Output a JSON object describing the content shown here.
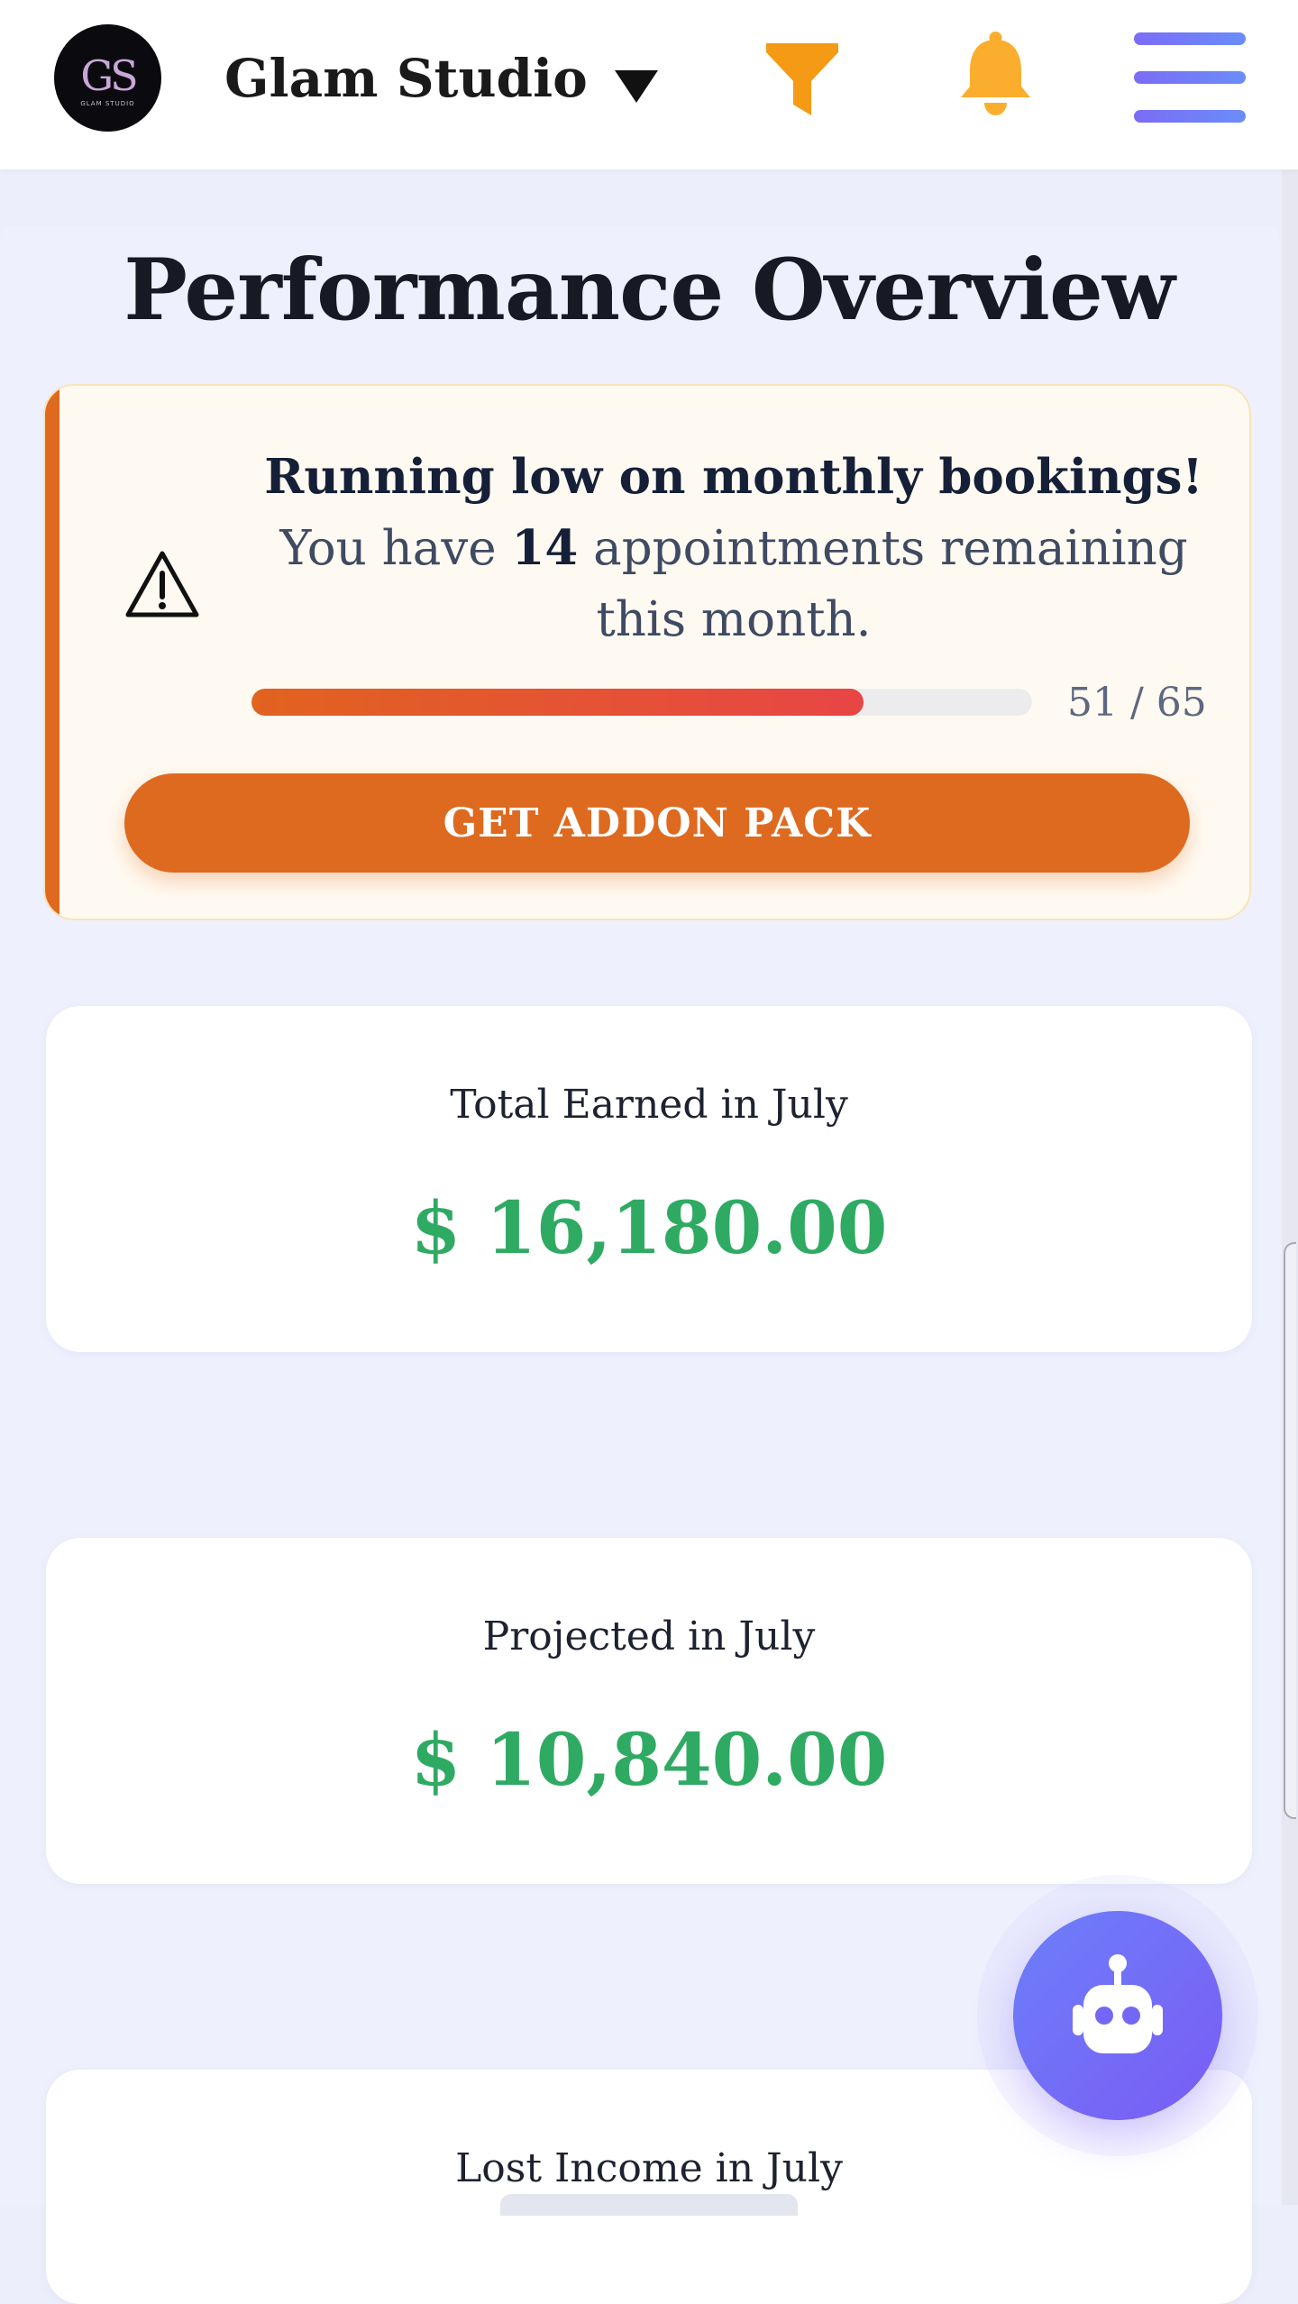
{
  "header": {
    "studio_name": "Glam Studio",
    "logo": {
      "mark": "GS",
      "text": "GLAM STUDIO"
    },
    "icons": {
      "caret": "caret-down-icon",
      "filter": "filter-icon",
      "bell": "bell-icon",
      "menu": "hamburger-menu-icon"
    },
    "colors": {
      "filter": "#f59a14",
      "bell": "#fbad2e",
      "menu": "#7377f6"
    }
  },
  "page": {
    "title": "Performance Overview"
  },
  "alert": {
    "headline": "Running low on monthly bookings!",
    "message_prefix": "You have",
    "remaining_count": "14",
    "message_suffix": "appointments remaining this month.",
    "used": 51,
    "limit": 65,
    "progress_label": "51 / 65",
    "button_label": "GET ADDON PACK",
    "icon": "warning-icon",
    "accent_color": "#de6a20"
  },
  "stats": [
    {
      "label": "Total Earned in July",
      "value": "$ 16,180.00"
    },
    {
      "label": "Projected in July",
      "value": "$ 10,840.00"
    },
    {
      "label": "Lost Income in July",
      "value": ""
    }
  ],
  "chatbot": {
    "icon": "robot-icon",
    "color": "#7a6cf7"
  }
}
